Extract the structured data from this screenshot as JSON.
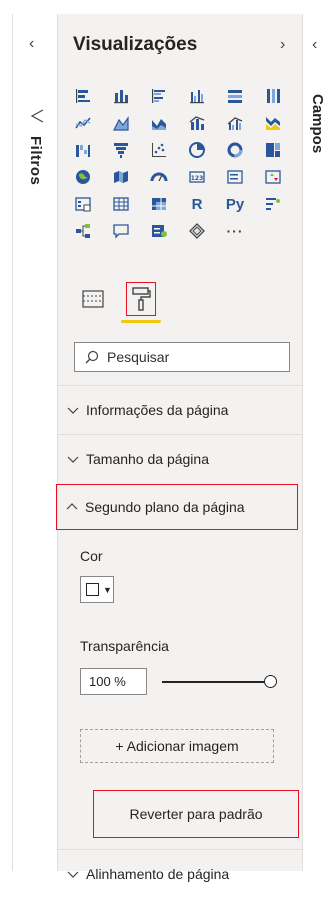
{
  "filters": {
    "label": "Filtros",
    "collapse_glyph": "‹"
  },
  "fields": {
    "label": "Campos",
    "collapse_glyph": "‹"
  },
  "visualizations": {
    "title": "Visualizações",
    "collapse_glyph": "›",
    "more_glyph": "···",
    "r_label": "R",
    "py_label": "Py",
    "search_placeholder": "Pesquisar"
  },
  "sections": {
    "page_info": "Informações da página",
    "page_size": "Tamanho da página",
    "page_background": "Segundo plano da página",
    "page_alignment": "Alinhamento de página"
  },
  "background": {
    "color_label": "Cor",
    "color_value": "#ffffff",
    "transparency_label": "Transparência",
    "transparency_value": "100 %",
    "add_image_label": "+ Adicionar imagem",
    "revert_label": "Reverter para padrão"
  },
  "colors": {
    "accent_blue": "#2b579a",
    "accent_yellow": "#f2c811",
    "highlight_red": "#e81123"
  }
}
